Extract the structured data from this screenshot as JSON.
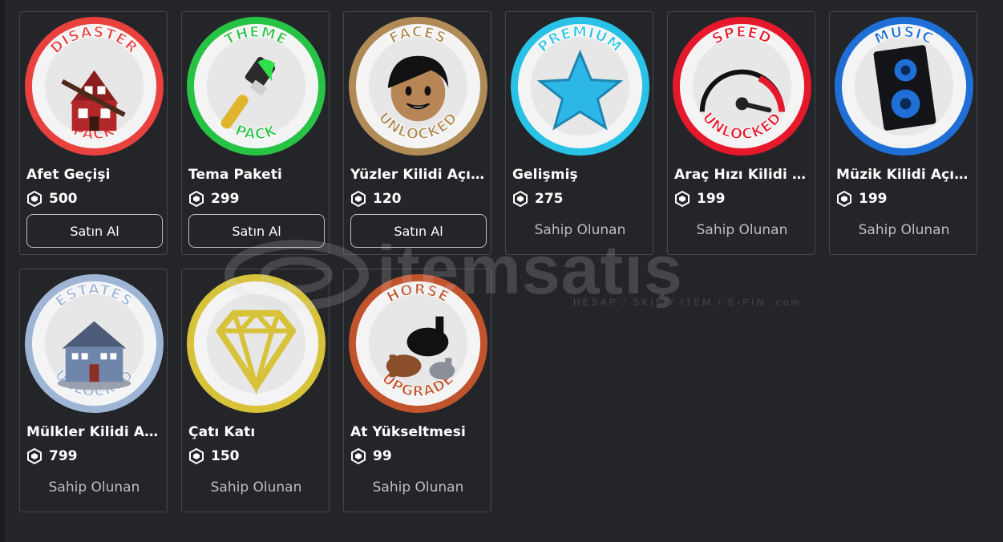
{
  "items": [
    {
      "name": "Afet Geçişi",
      "price": "500",
      "status": "buy",
      "action_label": "Satın Al",
      "badge_top": "DISASTER",
      "badge_bottom": "PACK",
      "ring_color": "#e8413e",
      "icon": "house-icon"
    },
    {
      "name": "Tema Paketi",
      "price": "299",
      "status": "buy",
      "action_label": "Satın Al",
      "badge_top": "THEME",
      "badge_bottom": "PACK",
      "ring_color": "#27c345",
      "icon": "paintbrush-icon"
    },
    {
      "name": "Yüzler Kilidi Açıldı",
      "price": "120",
      "status": "buy",
      "action_label": "Satın Al",
      "badge_top": "FACES",
      "badge_bottom": "UNLOCKED",
      "ring_color": "#b08b55",
      "icon": "face-icon"
    },
    {
      "name": "Gelişmiş",
      "price": "275",
      "status": "owned",
      "action_label": "Sahip Olunan",
      "badge_top": "PREMIUM",
      "badge_bottom": "",
      "ring_color": "#28c2e6",
      "icon": "star-icon"
    },
    {
      "name": "Araç Hızı Kilidi Açıldı",
      "price": "199",
      "status": "owned",
      "action_label": "Sahip Olunan",
      "badge_top": "SPEED",
      "badge_bottom": "UNLOCKED",
      "ring_color": "#e5192b",
      "icon": "speedometer-icon"
    },
    {
      "name": "Müzik Kilidi Açıldı",
      "price": "199",
      "status": "owned",
      "action_label": "Sahip Olunan",
      "badge_top": "MUSIC",
      "badge_bottom": "",
      "ring_color": "#1f6fd6",
      "icon": "speaker-icon"
    },
    {
      "name": "Mülkler Kilidi Açıldı",
      "price": "799",
      "status": "owned",
      "action_label": "Sahip Olunan",
      "badge_top": "ESTATES",
      "badge_bottom": "UNLOCKED",
      "ring_color": "#9fb5d6",
      "icon": "mansion-icon"
    },
    {
      "name": "Çatı Katı",
      "price": "150",
      "status": "owned",
      "action_label": "Sahip Olunan",
      "badge_top": "",
      "badge_bottom": "",
      "ring_color": "#d7c23a",
      "icon": "diamond-icon"
    },
    {
      "name": "At Yükseltmesi",
      "price": "99",
      "status": "owned",
      "action_label": "Sahip Olunan",
      "badge_top": "HORSE",
      "badge_bottom": "UPGRADE",
      "ring_color": "#c2542c",
      "icon": "horse-icon"
    }
  ],
  "watermark": {
    "brand": "itemsatış",
    "tagline": "HESAP / SKIN / ITEM / E-PIN .com"
  }
}
